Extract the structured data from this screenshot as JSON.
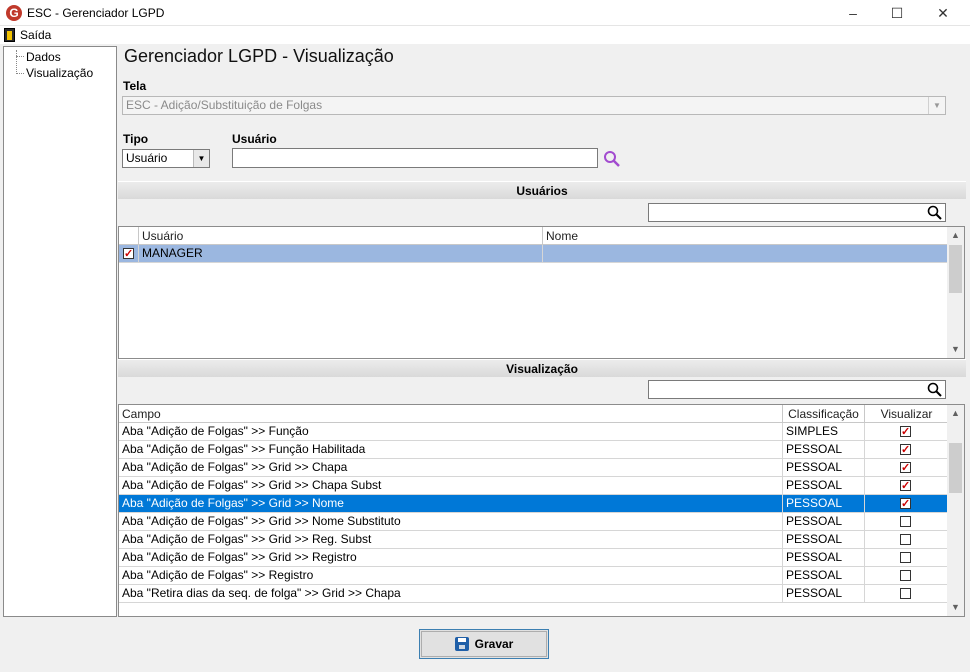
{
  "window": {
    "title": "ESC - Gerenciador LGPD",
    "logo": "G",
    "minimize": "–",
    "maximize": "☐",
    "close": "✕"
  },
  "menu": {
    "exit_label": "Saída"
  },
  "tree": {
    "items": [
      "Dados",
      "Visualização"
    ]
  },
  "page_title": "Gerenciador LGPD - Visualização",
  "form": {
    "tela_label": "Tela",
    "tela_value": "ESC - Adição/Substituição de Folgas",
    "tipo_label": "Tipo",
    "tipo_value": "Usuário",
    "usuario_label": "Usuário",
    "usuario_value": ""
  },
  "users_section": {
    "title": "Usuários",
    "columns": [
      "Usuário",
      "Nome"
    ],
    "rows": [
      {
        "checked": true,
        "usuario": "MANAGER",
        "nome": ""
      }
    ]
  },
  "view_section": {
    "title": "Visualização",
    "columns": [
      "Campo",
      "Classificação",
      "Visualizar"
    ],
    "rows": [
      {
        "campo": "Aba \"Adição de Folgas\" >> Função",
        "classificacao": "SIMPLES",
        "visualizar": true,
        "selected": false
      },
      {
        "campo": "Aba \"Adição de Folgas\" >> Função Habilitada",
        "classificacao": "PESSOAL",
        "visualizar": true,
        "selected": false
      },
      {
        "campo": "Aba \"Adição de Folgas\" >> Grid >> Chapa",
        "classificacao": "PESSOAL",
        "visualizar": true,
        "selected": false
      },
      {
        "campo": "Aba \"Adição de Folgas\" >> Grid >> Chapa Subst",
        "classificacao": "PESSOAL",
        "visualizar": true,
        "selected": false
      },
      {
        "campo": "Aba \"Adição de Folgas\" >> Grid >> Nome",
        "classificacao": "PESSOAL",
        "visualizar": true,
        "selected": true
      },
      {
        "campo": "Aba \"Adição de Folgas\" >> Grid >> Nome Substituto",
        "classificacao": "PESSOAL",
        "visualizar": false,
        "selected": false
      },
      {
        "campo": "Aba \"Adição de Folgas\" >> Grid >> Reg. Subst",
        "classificacao": "PESSOAL",
        "visualizar": false,
        "selected": false
      },
      {
        "campo": "Aba \"Adição de Folgas\" >> Grid >> Registro",
        "classificacao": "PESSOAL",
        "visualizar": false,
        "selected": false
      },
      {
        "campo": "Aba \"Adição de Folgas\" >> Registro",
        "classificacao": "PESSOAL",
        "visualizar": false,
        "selected": false
      },
      {
        "campo": "Aba \"Retira dias da seq. de folga\" >> Grid >> Chapa",
        "classificacao": "PESSOAL",
        "visualizar": false,
        "selected": false
      }
    ]
  },
  "save_button": {
    "label": "Gravar"
  },
  "colors": {
    "selected_row": "#0078d7",
    "user_row": "#9bb7e0",
    "accent_red": "#c00000"
  }
}
